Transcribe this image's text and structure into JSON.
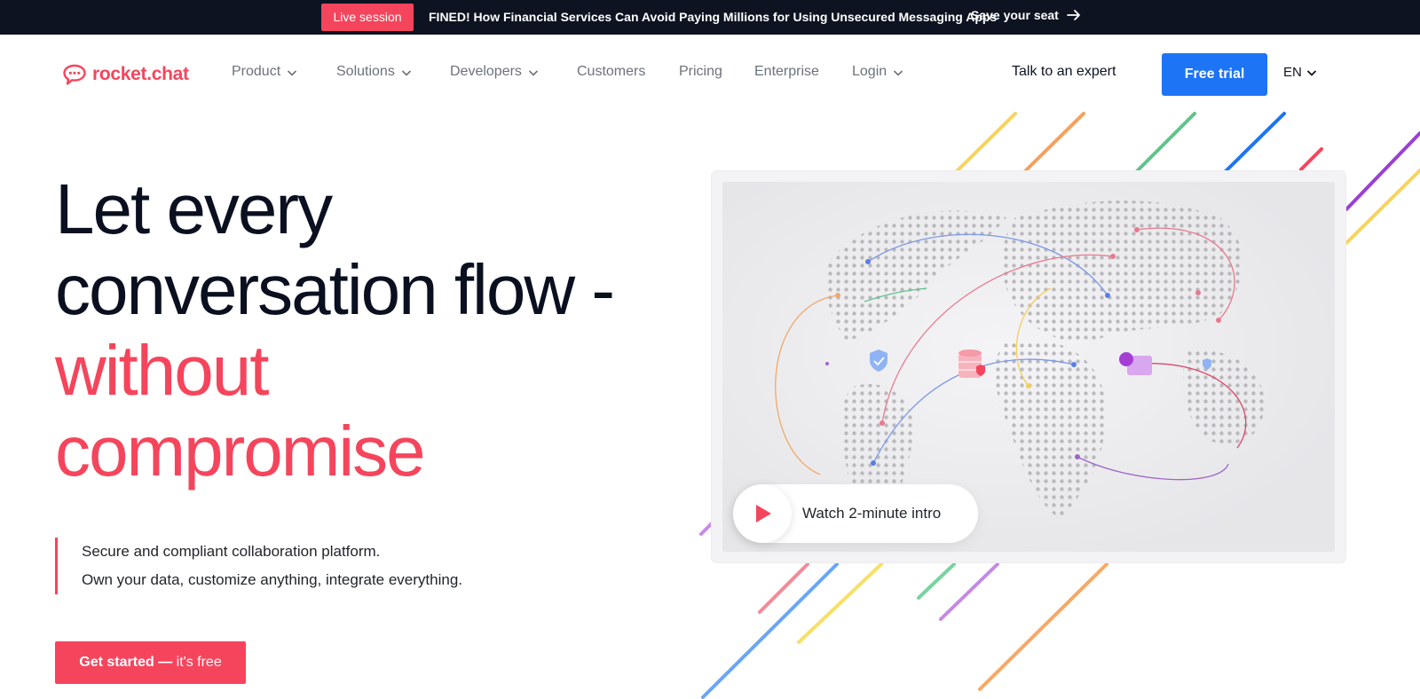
{
  "announcement": {
    "badge": "Live session",
    "text": "FINED! How Financial Services Can Avoid Paying Millions for Using Unsecured Messaging Apps",
    "link": "Save your seat"
  },
  "header": {
    "logo_text": "rocket.chat",
    "nav": {
      "product": "Product",
      "solutions": "Solutions",
      "developers": "Developers",
      "customers": "Customers",
      "pricing": "Pricing",
      "enterprise": "Enterprise",
      "login": "Login"
    },
    "talk": "Talk to an expert",
    "free_trial": "Free trial",
    "lang": "EN"
  },
  "hero": {
    "line1": "Let every",
    "line2": "conversation flow -",
    "line3": "without",
    "line4": "compromise",
    "sub1": "Secure and compliant collaboration platform.",
    "sub2": "Own your data, customize anything, integrate everything.",
    "cta_bold": "Get started —",
    "cta_rest": " it's free"
  },
  "video": {
    "label": "Watch 2-minute intro"
  },
  "colors": {
    "brand_red": "#f5455c",
    "brand_blue": "#1d74f5",
    "announce_bg": "#0d1321"
  },
  "icons": [
    "chat-bubble-logo-icon",
    "chevron-down-icon",
    "arrow-right-icon",
    "play-icon",
    "shield-icon",
    "database-icon",
    "chat-icon"
  ]
}
